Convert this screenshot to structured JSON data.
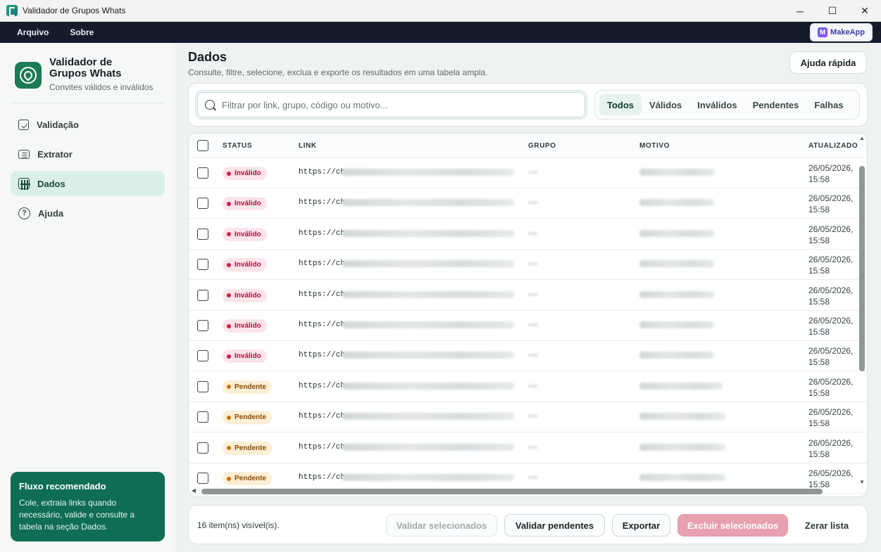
{
  "window": {
    "title": "Validador de Grupos Whats",
    "minimize": "─",
    "maximize": "☐",
    "close": "✕"
  },
  "menu": {
    "items": [
      "Arquivo",
      "Sobre"
    ],
    "brand_badge": "MakeApp",
    "brand_badge_letter": "M"
  },
  "sidebar": {
    "brand_title": "Validador de Grupos Whats",
    "brand_subtitle": "Convites válidos e inválidos",
    "nav": [
      {
        "label": "Validação",
        "icon": "check-square-icon"
      },
      {
        "label": "Extrator",
        "icon": "list-icon"
      },
      {
        "label": "Dados",
        "icon": "table-icon",
        "active": true
      },
      {
        "label": "Ajuda",
        "icon": "help-circle-icon"
      }
    ],
    "flow_card": {
      "title": "Fluxo recomendado",
      "text": "Cole, extraia links quando necessário, valide e consulte a tabela na seção Dados."
    }
  },
  "main": {
    "title": "Dados",
    "subtitle": "Consulte, filtre, selecione, exclua e exporte os resultados em uma tabela ampla.",
    "help_button": "Ajuda rápida",
    "search": {
      "placeholder": "Filtrar por link, grupo, código ou motivo...",
      "value": ""
    },
    "filters": [
      "Todos",
      "Válidos",
      "Inválidos",
      "Pendentes",
      "Falhas"
    ],
    "active_filter": "Todos",
    "table": {
      "columns": [
        "STATUS",
        "LINK",
        "GRUPO",
        "MOTIVO",
        "ATUALIZADO"
      ],
      "rows": [
        {
          "status": "Inválido",
          "kind": "invalid",
          "link": "https://ch",
          "updated_1": "26/05/2026,",
          "updated_2": "15:58"
        },
        {
          "status": "Inválido",
          "kind": "invalid",
          "link": "https://ch",
          "updated_1": "26/05/2026,",
          "updated_2": "15:58"
        },
        {
          "status": "Inválido",
          "kind": "invalid",
          "link": "https://ch",
          "updated_1": "26/05/2026,",
          "updated_2": "15:58"
        },
        {
          "status": "Inválido",
          "kind": "invalid",
          "link": "https://ch",
          "updated_1": "26/05/2026,",
          "updated_2": "15:58"
        },
        {
          "status": "Inválido",
          "kind": "invalid",
          "link": "https://ch",
          "updated_1": "26/05/2026,",
          "updated_2": "15:58"
        },
        {
          "status": "Inválido",
          "kind": "invalid",
          "link": "https://ch",
          "updated_1": "26/05/2026,",
          "updated_2": "15:58"
        },
        {
          "status": "Inválido",
          "kind": "invalid",
          "link": "https://ch",
          "updated_1": "26/05/2026,",
          "updated_2": "15:58"
        },
        {
          "status": "Pendente",
          "kind": "pending",
          "link": "https://ch",
          "updated_1": "26/05/2026,",
          "updated_2": "15:58"
        },
        {
          "status": "Pendente",
          "kind": "pending",
          "link": "https://ch",
          "updated_1": "26/05/2026,",
          "updated_2": "15:58"
        },
        {
          "status": "Pendente",
          "kind": "pending",
          "link": "https://ch",
          "updated_1": "26/05/2026,",
          "updated_2": "15:58"
        },
        {
          "status": "Pendente",
          "kind": "pending",
          "link": "https://ch",
          "updated_1": "26/05/2026,",
          "updated_2": "15:58"
        }
      ]
    },
    "footer": {
      "count_text": "16 item(ns) visível(is).",
      "validate_selected": "Validar selecionados",
      "validate_pending": "Validar pendentes",
      "export": "Exportar",
      "delete_selected": "Excluir selecionados",
      "clear_list": "Zerar lista"
    }
  },
  "colors": {
    "menubar": "#141c2b",
    "accent": "#0f6d55",
    "invalid": "#d21c4a",
    "pending": "#c87302",
    "danger_button": "#e8a0ae"
  }
}
